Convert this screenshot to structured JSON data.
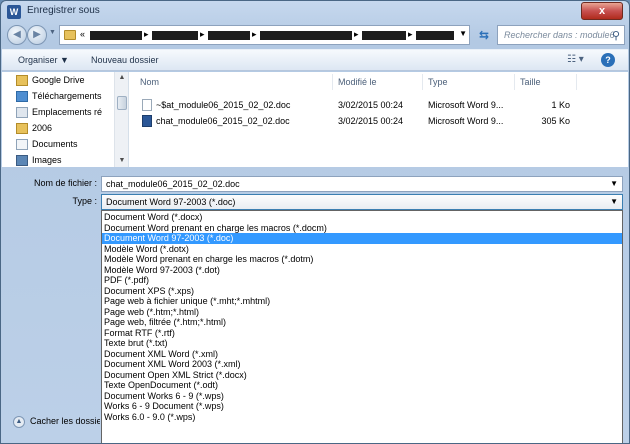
{
  "window": {
    "title": "Enregistrer sous",
    "close_label": "x",
    "app_icon_letter": "W"
  },
  "address": {
    "first_segment": "«",
    "separator": "▸",
    "search_placeholder": "Rechercher dans : module6"
  },
  "toolbar": {
    "organize_label": "Organiser ▼",
    "new_folder_label": "Nouveau dossier"
  },
  "nav_pane": {
    "items": [
      {
        "label": "Google Drive",
        "icon": "google-drive-folder-icon",
        "color": "#e7c15b"
      },
      {
        "label": "Téléchargements",
        "icon": "downloads-folder-icon",
        "color": "#4f8ed1"
      },
      {
        "label": "Emplacements ré",
        "icon": "recent-places-icon",
        "color": "#8fa3b8"
      },
      {
        "label": "2006",
        "icon": "folder-icon",
        "color": "#e7c15b"
      },
      {
        "label": "Documents",
        "icon": "documents-icon",
        "color": "#c9d5e2"
      },
      {
        "label": "Images",
        "icon": "images-icon",
        "color": "#5b86b5"
      }
    ]
  },
  "file_list": {
    "columns": {
      "name": "Nom",
      "modified": "Modifié le",
      "type": "Type",
      "size": "Taille"
    },
    "rows": [
      {
        "name": "~$at_module06_2015_02_02.doc",
        "modified": "3/02/2015 00:24",
        "type": "Microsoft Word 9...",
        "size": "1 Ko"
      },
      {
        "name": "chat_module06_2015_02_02.doc",
        "modified": "3/02/2015 00:24",
        "type": "Microsoft Word 9...",
        "size": "305 Ko"
      }
    ]
  },
  "form": {
    "filename_label": "Nom de fichier :",
    "filename_value": "chat_module06_2015_02_02.doc",
    "type_label": "Type :",
    "type_value": "Document Word 97-2003 (*.doc)"
  },
  "type_options": [
    "Document Word (*.docx)",
    "Document Word prenant en charge les macros (*.docm)",
    "Document Word 97-2003 (*.doc)",
    "Modèle Word (*.dotx)",
    "Modèle Word prenant en charge les macros (*.dotm)",
    "Modèle Word 97-2003 (*.dot)",
    "PDF (*.pdf)",
    "Document XPS (*.xps)",
    "Page web à fichier unique (*.mht;*.mhtml)",
    "Page web (*.htm;*.html)",
    "Page web, filtrée (*.htm;*.html)",
    "Format RTF (*.rtf)",
    "Texte brut (*.txt)",
    "Document XML Word (*.xml)",
    "Document XML Word 2003 (*.xml)",
    "Document Open XML Strict (*.docx)",
    "Texte OpenDocument (*.odt)",
    "Document Works 6 - 9 (*.wps)",
    "Works 6 - 9 Document (*.wps)",
    "Works 6.0 - 9.0 (*.wps)"
  ],
  "selected_type_index": 2,
  "hide_folders_label": "Cacher les dossiers",
  "colors": {
    "selection": "#3399ff",
    "window_frame": "#b3c9e3"
  }
}
